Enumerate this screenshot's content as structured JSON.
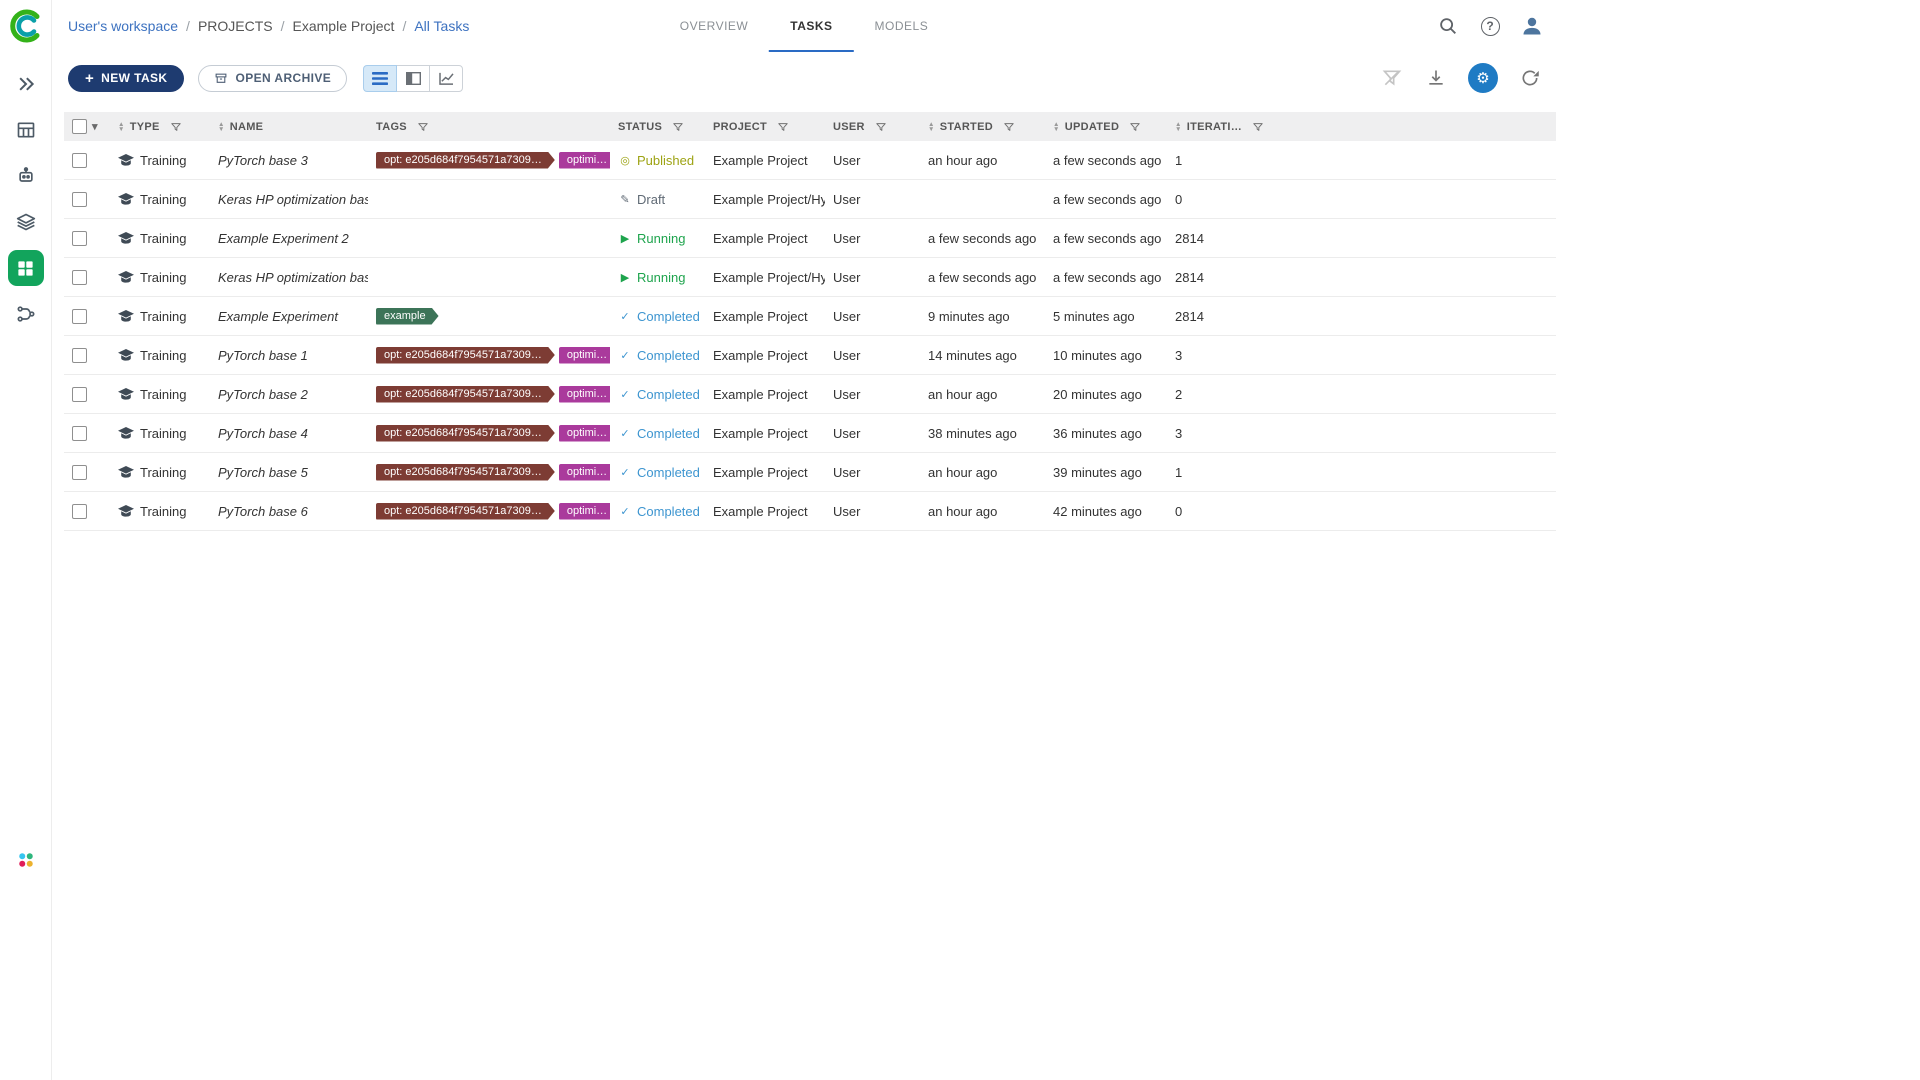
{
  "app": {
    "title": "ClearML"
  },
  "breadcrumb": {
    "items": [
      {
        "label": "User's workspace",
        "link": true
      },
      {
        "label": "PROJECTS",
        "link": false
      },
      {
        "label": "Example Project",
        "link": false
      },
      {
        "label": "All Tasks",
        "link": true
      }
    ]
  },
  "tabs": [
    {
      "label": "OVERVIEW",
      "active": false
    },
    {
      "label": "TASKS",
      "active": true
    },
    {
      "label": "MODELS",
      "active": false
    }
  ],
  "toolbar": {
    "new_task_label": "NEW TASK",
    "open_archive_label": "OPEN ARCHIVE"
  },
  "icons": {
    "plus": "+",
    "help": "?",
    "gear": "⚙",
    "caret_down": "▾",
    "sort_up": "▲",
    "sort_down": "▼"
  },
  "colors": {
    "accent_blue": "#2a6bc4",
    "sidebar_active_green": "#12a45c",
    "new_task_bg": "#1e3b70"
  },
  "table": {
    "columns": [
      {
        "key": "select",
        "label": "",
        "sort": false,
        "filter": false
      },
      {
        "key": "type",
        "label": "TYPE",
        "sort": true,
        "filter": true
      },
      {
        "key": "name",
        "label": "NAME",
        "sort": true,
        "filter": false
      },
      {
        "key": "tags",
        "label": "TAGS",
        "sort": false,
        "filter": true
      },
      {
        "key": "status",
        "label": "STATUS",
        "sort": false,
        "filter": true
      },
      {
        "key": "project",
        "label": "PROJECT",
        "sort": false,
        "filter": true
      },
      {
        "key": "user",
        "label": "USER",
        "sort": false,
        "filter": true
      },
      {
        "key": "started",
        "label": "STARTED",
        "sort": true,
        "filter": true
      },
      {
        "key": "updated",
        "label": "UPDATED",
        "sort": true,
        "filter": true
      },
      {
        "key": "iterations",
        "label": "ITERATI…",
        "sort": true,
        "filter": true
      }
    ],
    "status_styles": {
      "Published": {
        "color": "#9da313",
        "icon": "◎"
      },
      "Draft": {
        "color": "#606a75",
        "icon": "✎"
      },
      "Running": {
        "color": "#1ea44d",
        "icon": "▶"
      },
      "Completed": {
        "color": "#3d95d0",
        "icon": "✓"
      }
    },
    "rows": [
      {
        "type": "Training",
        "name": "PyTorch base 3",
        "tags": [
          {
            "label": "opt: e205d684f7954571a7309…",
            "color": "#7d3c34"
          },
          {
            "label": "optimi…",
            "color": "#aa3a9c"
          }
        ],
        "status": "Published",
        "project": "Example Project",
        "user": "User",
        "started": "an hour ago",
        "updated": "a few seconds ago",
        "iterations": "1"
      },
      {
        "type": "Training",
        "name": "Keras HP optimization base",
        "tags": [],
        "status": "Draft",
        "project": "Example Project/Hy…",
        "user": "User",
        "started": "",
        "updated": "a few seconds ago",
        "iterations": "0"
      },
      {
        "type": "Training",
        "name": "Example Experiment 2",
        "tags": [],
        "status": "Running",
        "project": "Example Project",
        "user": "User",
        "started": "a few seconds ago",
        "updated": "a few seconds ago",
        "iterations": "2814"
      },
      {
        "type": "Training",
        "name": "Keras HP optimization base",
        "tags": [],
        "status": "Running",
        "project": "Example Project/Hy…",
        "user": "User",
        "started": "a few seconds ago",
        "updated": "a few seconds ago",
        "iterations": "2814"
      },
      {
        "type": "Training",
        "name": "Example Experiment",
        "tags": [
          {
            "label": "example",
            "color": "#3c7458"
          }
        ],
        "status": "Completed",
        "project": "Example Project",
        "user": "User",
        "started": "9 minutes ago",
        "updated": "5 minutes ago",
        "iterations": "2814"
      },
      {
        "type": "Training",
        "name": "PyTorch base 1",
        "tags": [
          {
            "label": "opt: e205d684f7954571a7309…",
            "color": "#7d3c34"
          },
          {
            "label": "optimi…",
            "color": "#aa3a9c"
          }
        ],
        "status": "Completed",
        "project": "Example Project",
        "user": "User",
        "started": "14 minutes ago",
        "updated": "10 minutes ago",
        "iterations": "3"
      },
      {
        "type": "Training",
        "name": "PyTorch base 2",
        "tags": [
          {
            "label": "opt: e205d684f7954571a7309…",
            "color": "#7d3c34"
          },
          {
            "label": "optimi…",
            "color": "#aa3a9c"
          }
        ],
        "status": "Completed",
        "project": "Example Project",
        "user": "User",
        "started": "an hour ago",
        "updated": "20 minutes ago",
        "iterations": "2"
      },
      {
        "type": "Training",
        "name": "PyTorch base 4",
        "tags": [
          {
            "label": "opt: e205d684f7954571a7309…",
            "color": "#7d3c34"
          },
          {
            "label": "optimi…",
            "color": "#aa3a9c"
          }
        ],
        "status": "Completed",
        "project": "Example Project",
        "user": "User",
        "started": "38 minutes ago",
        "updated": "36 minutes ago",
        "iterations": "3"
      },
      {
        "type": "Training",
        "name": "PyTorch base 5",
        "tags": [
          {
            "label": "opt: e205d684f7954571a7309…",
            "color": "#7d3c34"
          },
          {
            "label": "optimi…",
            "color": "#aa3a9c"
          }
        ],
        "status": "Completed",
        "project": "Example Project",
        "user": "User",
        "started": "an hour ago",
        "updated": "39 minutes ago",
        "iterations": "1"
      },
      {
        "type": "Training",
        "name": "PyTorch base 6",
        "tags": [
          {
            "label": "opt: e205d684f7954571a7309…",
            "color": "#7d3c34"
          },
          {
            "label": "optimi…",
            "color": "#aa3a9c"
          }
        ],
        "status": "Completed",
        "project": "Example Project",
        "user": "User",
        "started": "an hour ago",
        "updated": "42 minutes ago",
        "iterations": "0"
      }
    ]
  }
}
